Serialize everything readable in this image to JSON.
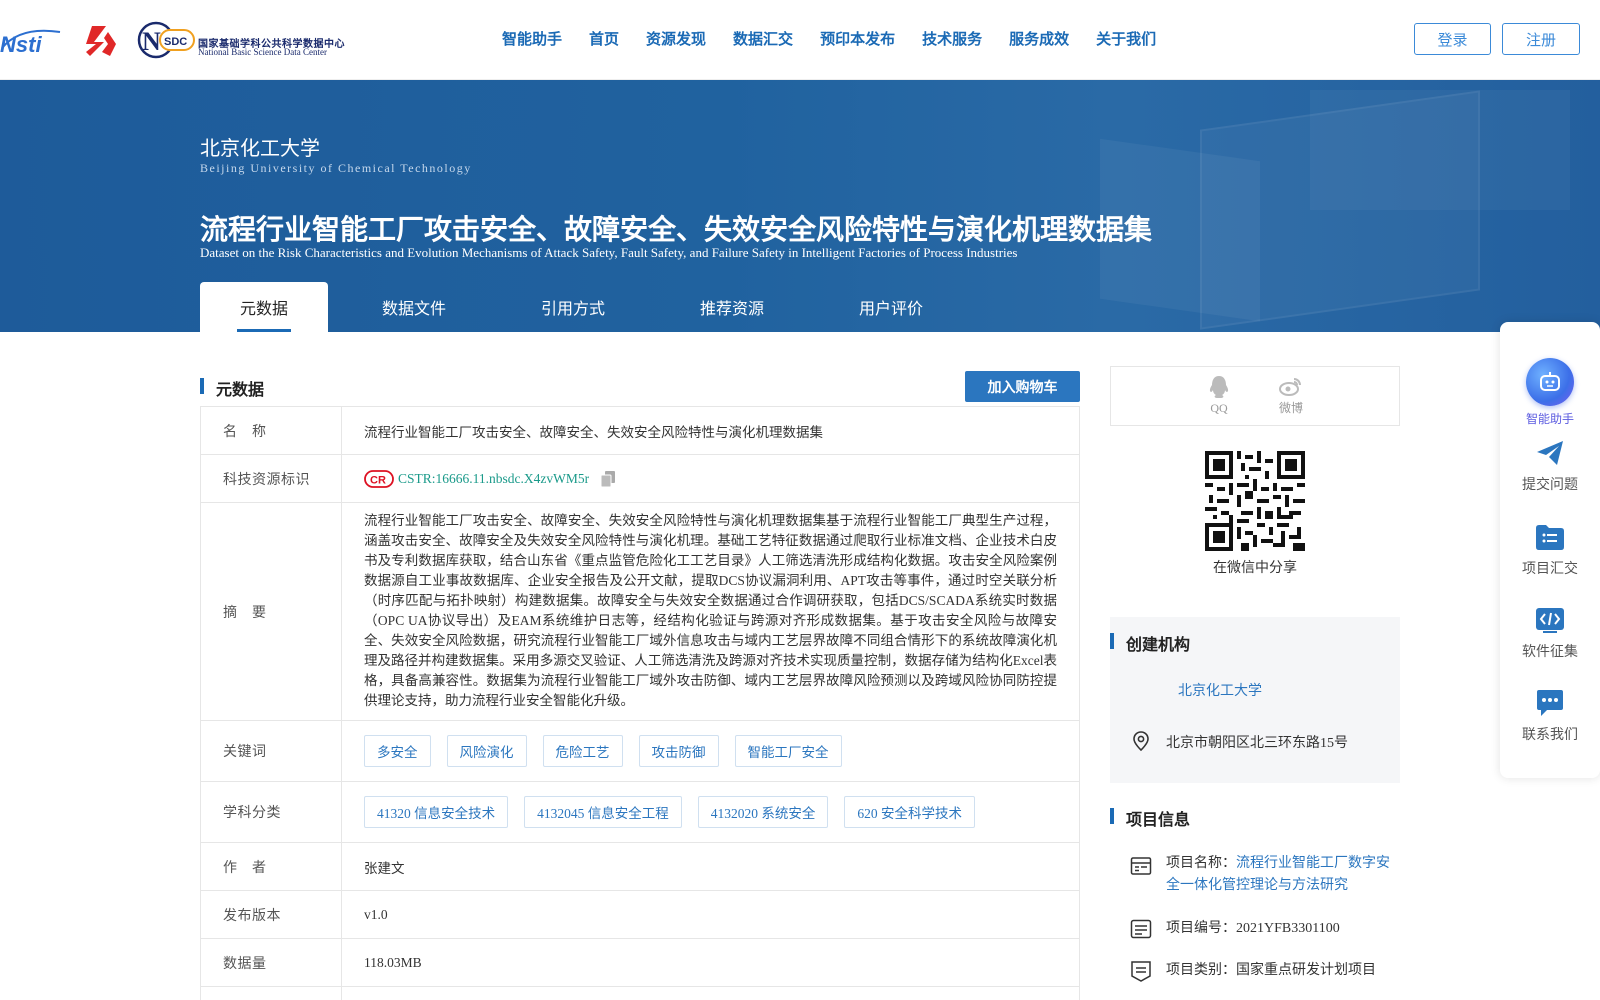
{
  "header": {
    "logo_nsti": "Nsti",
    "logo_nsdc_cn": "国家基础学科公共科学数据中心",
    "logo_nsdc_en": "National Basic Science Data Center",
    "nav": [
      "智能助手",
      "首页",
      "资源发现",
      "数据汇交",
      "预印本发布",
      "技术服务",
      "服务成效",
      "关于我们"
    ],
    "login": "登录",
    "register": "注册"
  },
  "banner": {
    "institution": "北京化工大学",
    "institution_en": "Beijing University of Chemical Technology",
    "title": "流程行业智能工厂攻击安全、故障安全、失效安全风险特性与演化机理数据集",
    "title_en": "Dataset on the Risk Characteristics and Evolution Mechanisms of Attack Safety, Fault Safety, and Failure Safety in Intelligent Factories of Process Industries",
    "tabs": [
      "元数据",
      "数据文件",
      "引用方式",
      "推荐资源",
      "用户评价"
    ],
    "active_tab": "元数据"
  },
  "metadata": {
    "section_title": "元数据",
    "add_to_cart": "加入购物车",
    "rows": {
      "name_label": "名　称",
      "name_value": "流程行业智能工厂攻击安全、故障安全、失效安全风险特性与演化机理数据集",
      "id_label": "科技资源标识",
      "id_value": "CSTR:16666.11.nbsdc.X4zvWM5r",
      "abstract_label": "摘　要",
      "abstract_value": "流程行业智能工厂攻击安全、故障安全、失效安全风险特性与演化机理数据集基于流程行业智能工厂典型生产过程，涵盖攻击安全、故障安全及失效安全风险特性与演化机理。基础工艺特征数据通过爬取行业标准文档、企业技术白皮书及专利数据库获取，结合山东省《重点监管危险化工工艺目录》人工筛选清洗形成结构化数据。攻击安全风险案例数据源自工业事故数据库、企业安全报告及公开文献，提取DCS协议漏洞利用、APT攻击等事件，通过时空关联分析（时序匹配与拓扑映射）构建数据集。故障安全与失效安全数据通过合作调研获取，包括DCS/SCADA系统实时数据（OPC UA协议导出）及EAM系统维护日志等，经结构化验证与跨源对齐形成数据集。基于攻击安全风险与故障安全、失效安全风险数据，研究流程行业智能工厂域外信息攻击与域内工艺层界故障不同组合情形下的系统故障演化机理及路径并构建数据集。采用多源交叉验证、人工筛选清洗及跨源对齐技术实现质量控制，数据存储为结构化Excel表格，具备高兼容性。数据集为流程行业智能工厂域外攻击防御、域内工艺层界故障风险预测以及跨域风险协同防控提供理论支持，助力流程行业安全智能化升级。",
      "keywords_label": "关键词",
      "keywords": [
        "多安全",
        "风险演化",
        "危险工艺",
        "攻击防御",
        "智能工厂安全"
      ],
      "subject_label": "学科分类",
      "subjects": [
        "41320 信息安全技术",
        "4132045 信息安全工程",
        "4132020 系统安全",
        "620 安全科学技术"
      ],
      "author_label": "作　者",
      "author_value": "张建文",
      "version_label": "发布版本",
      "version_value": "v1.0",
      "size_label": "数据量",
      "size_value": "118.03MB"
    }
  },
  "share": {
    "qq": "QQ",
    "weibo": "微博",
    "wechat_caption": "在微信中分享"
  },
  "creator": {
    "title": "创建机构",
    "org": "北京化工大学",
    "address": "北京市朝阳区北三环东路15号"
  },
  "project": {
    "title": "项目信息",
    "name_label": "项目名称：",
    "name_value": "流程行业智能工厂数字安全一体化管控理论与方法研究",
    "code_label": "项目编号：",
    "code_value": "2021YFB3301100",
    "type_label": "项目类别：",
    "type_value": "国家重点研发计划项目"
  },
  "float_bar": {
    "ai": "智能助手",
    "submit": "提交问题",
    "project": "项目汇交",
    "software": "软件征集",
    "contact": "联系我们"
  },
  "colors": {
    "primary": "#1b6ab5",
    "banner": "#20629f",
    "link": "#2b76bf",
    "cstr": "#1a9a8a"
  }
}
